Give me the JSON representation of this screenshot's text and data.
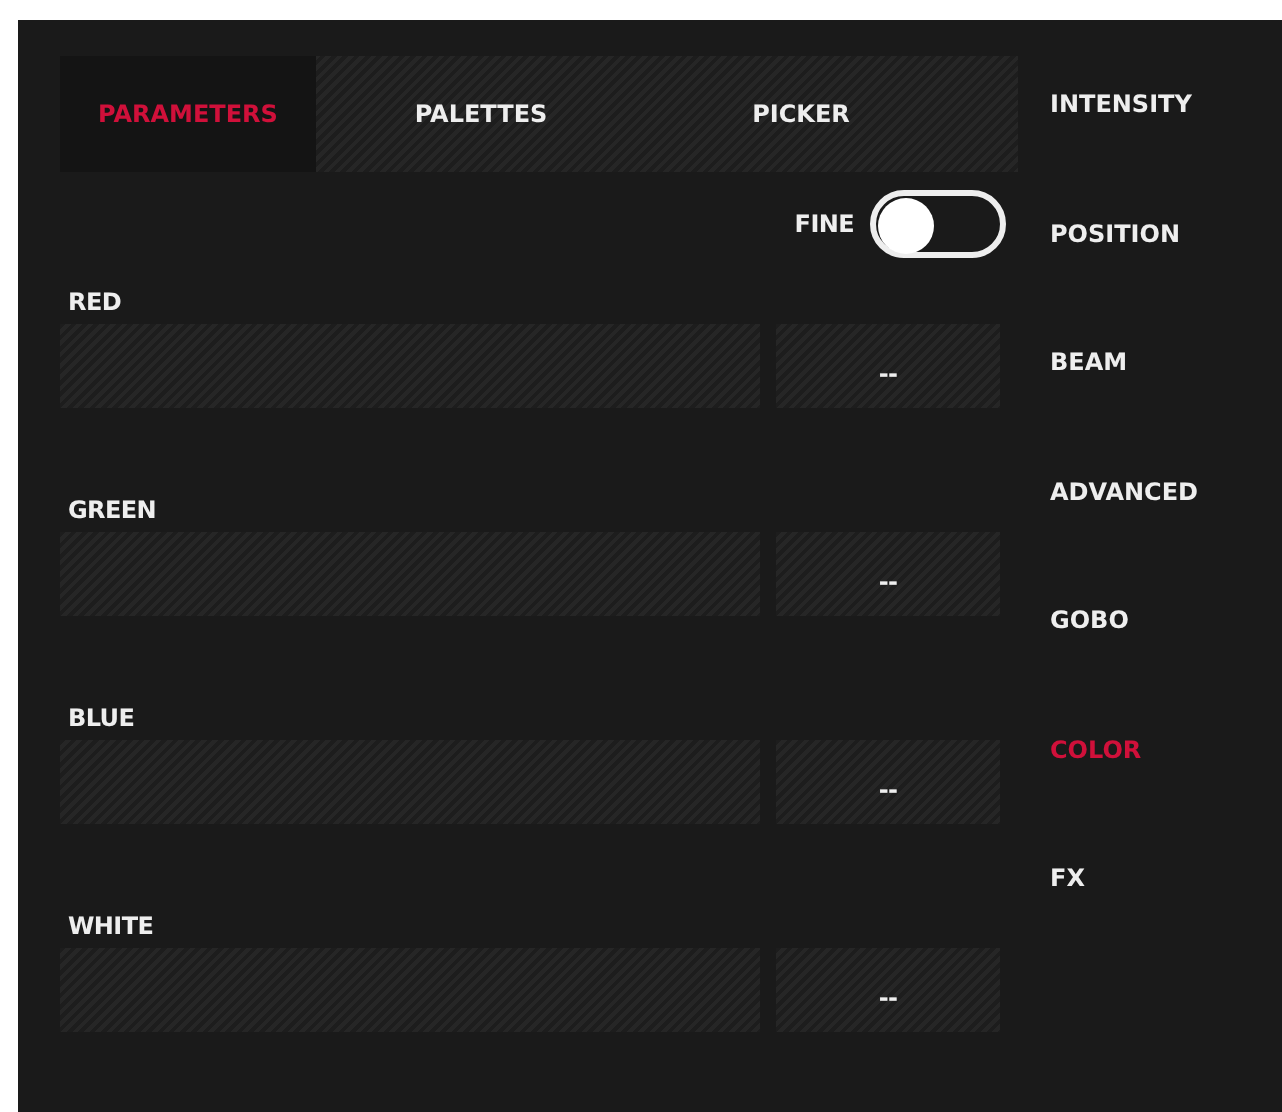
{
  "tabs": [
    {
      "label": "PARAMETERS",
      "selected": true
    },
    {
      "label": "PALETTES",
      "selected": false
    },
    {
      "label": "PICKER",
      "selected": false
    }
  ],
  "fine": {
    "label": "FINE",
    "on": false
  },
  "channels": [
    {
      "name": "RED",
      "value": "--"
    },
    {
      "name": "GREEN",
      "value": "--"
    },
    {
      "name": "BLUE",
      "value": "--"
    },
    {
      "name": "WHITE",
      "value": "--"
    }
  ],
  "sidebar": {
    "items": [
      {
        "label": "INTENSITY",
        "selected": false
      },
      {
        "label": "POSITION",
        "selected": false
      },
      {
        "label": "BEAM",
        "selected": false
      },
      {
        "label": "ADVANCED",
        "selected": false
      },
      {
        "label": "GOBO",
        "selected": false
      },
      {
        "label": "COLOR",
        "selected": true
      },
      {
        "label": "FX",
        "selected": false
      }
    ]
  }
}
